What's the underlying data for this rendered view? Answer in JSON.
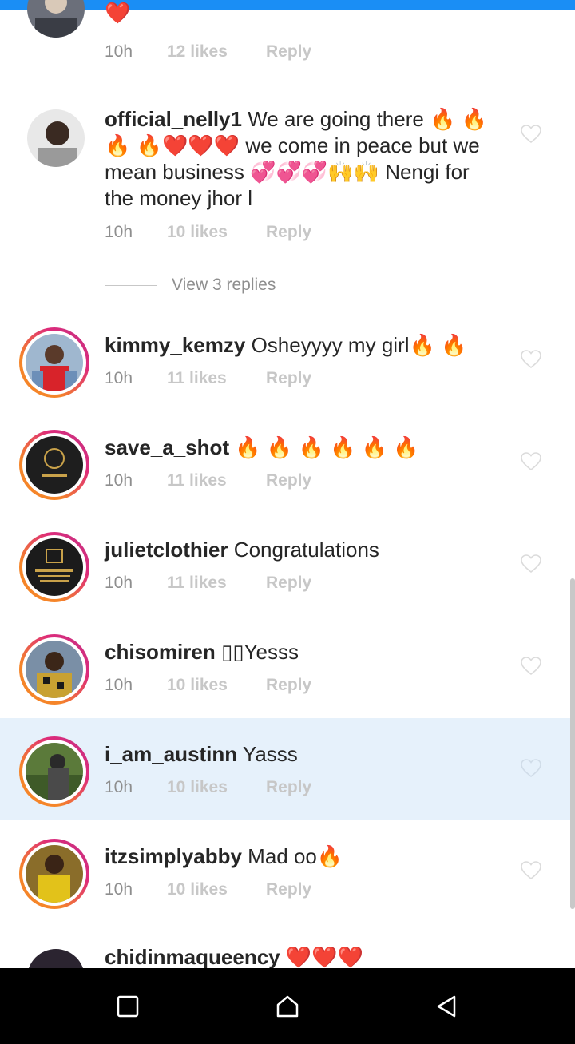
{
  "comments": [
    {
      "username": "",
      "text": "❤️",
      "time": "10h",
      "likes": "12 likes",
      "reply": "Reply"
    },
    {
      "username": "official_nelly1",
      "text": " We are going there 🔥 🔥 🔥 🔥❤️❤️❤️ we come in peace but we mean business 💞💞💞🙌🙌 Nengi for the money jhor l",
      "time": "10h",
      "likes": "10 likes",
      "reply": "Reply"
    },
    {
      "username": "kimmy_kemzy",
      "text": " Osheyyyy my girl🔥 🔥",
      "time": "10h",
      "likes": "11 likes",
      "reply": "Reply"
    },
    {
      "username": "save_a_shot",
      "text": " 🔥 🔥 🔥 🔥 🔥 🔥",
      "time": "10h",
      "likes": "11 likes",
      "reply": "Reply"
    },
    {
      "username": "julietclothier",
      "text": " Congratulations",
      "time": "10h",
      "likes": "11 likes",
      "reply": "Reply"
    },
    {
      "username": "chisomiren",
      "text": " ▯▯Yesss",
      "time": "10h",
      "likes": "10 likes",
      "reply": "Reply"
    },
    {
      "username": "i_am_austinn",
      "text": " Yasss",
      "time": "10h",
      "likes": "10 likes",
      "reply": "Reply"
    },
    {
      "username": "itzsimplyabby",
      "text": " Mad oo🔥",
      "time": "10h",
      "likes": "10 likes",
      "reply": "Reply"
    },
    {
      "username": "chidinmaqueency",
      "text": " ❤️❤️❤️",
      "time": "",
      "likes": "",
      "reply": ""
    }
  ],
  "view_replies": "View 3 replies",
  "colors": {
    "accent": "#1a8ef5",
    "highlight": "#e6f1fb",
    "meta": "#8e8e8e"
  },
  "nav": {
    "icons": [
      "square-icon",
      "home-icon",
      "back-triangle-icon"
    ]
  }
}
